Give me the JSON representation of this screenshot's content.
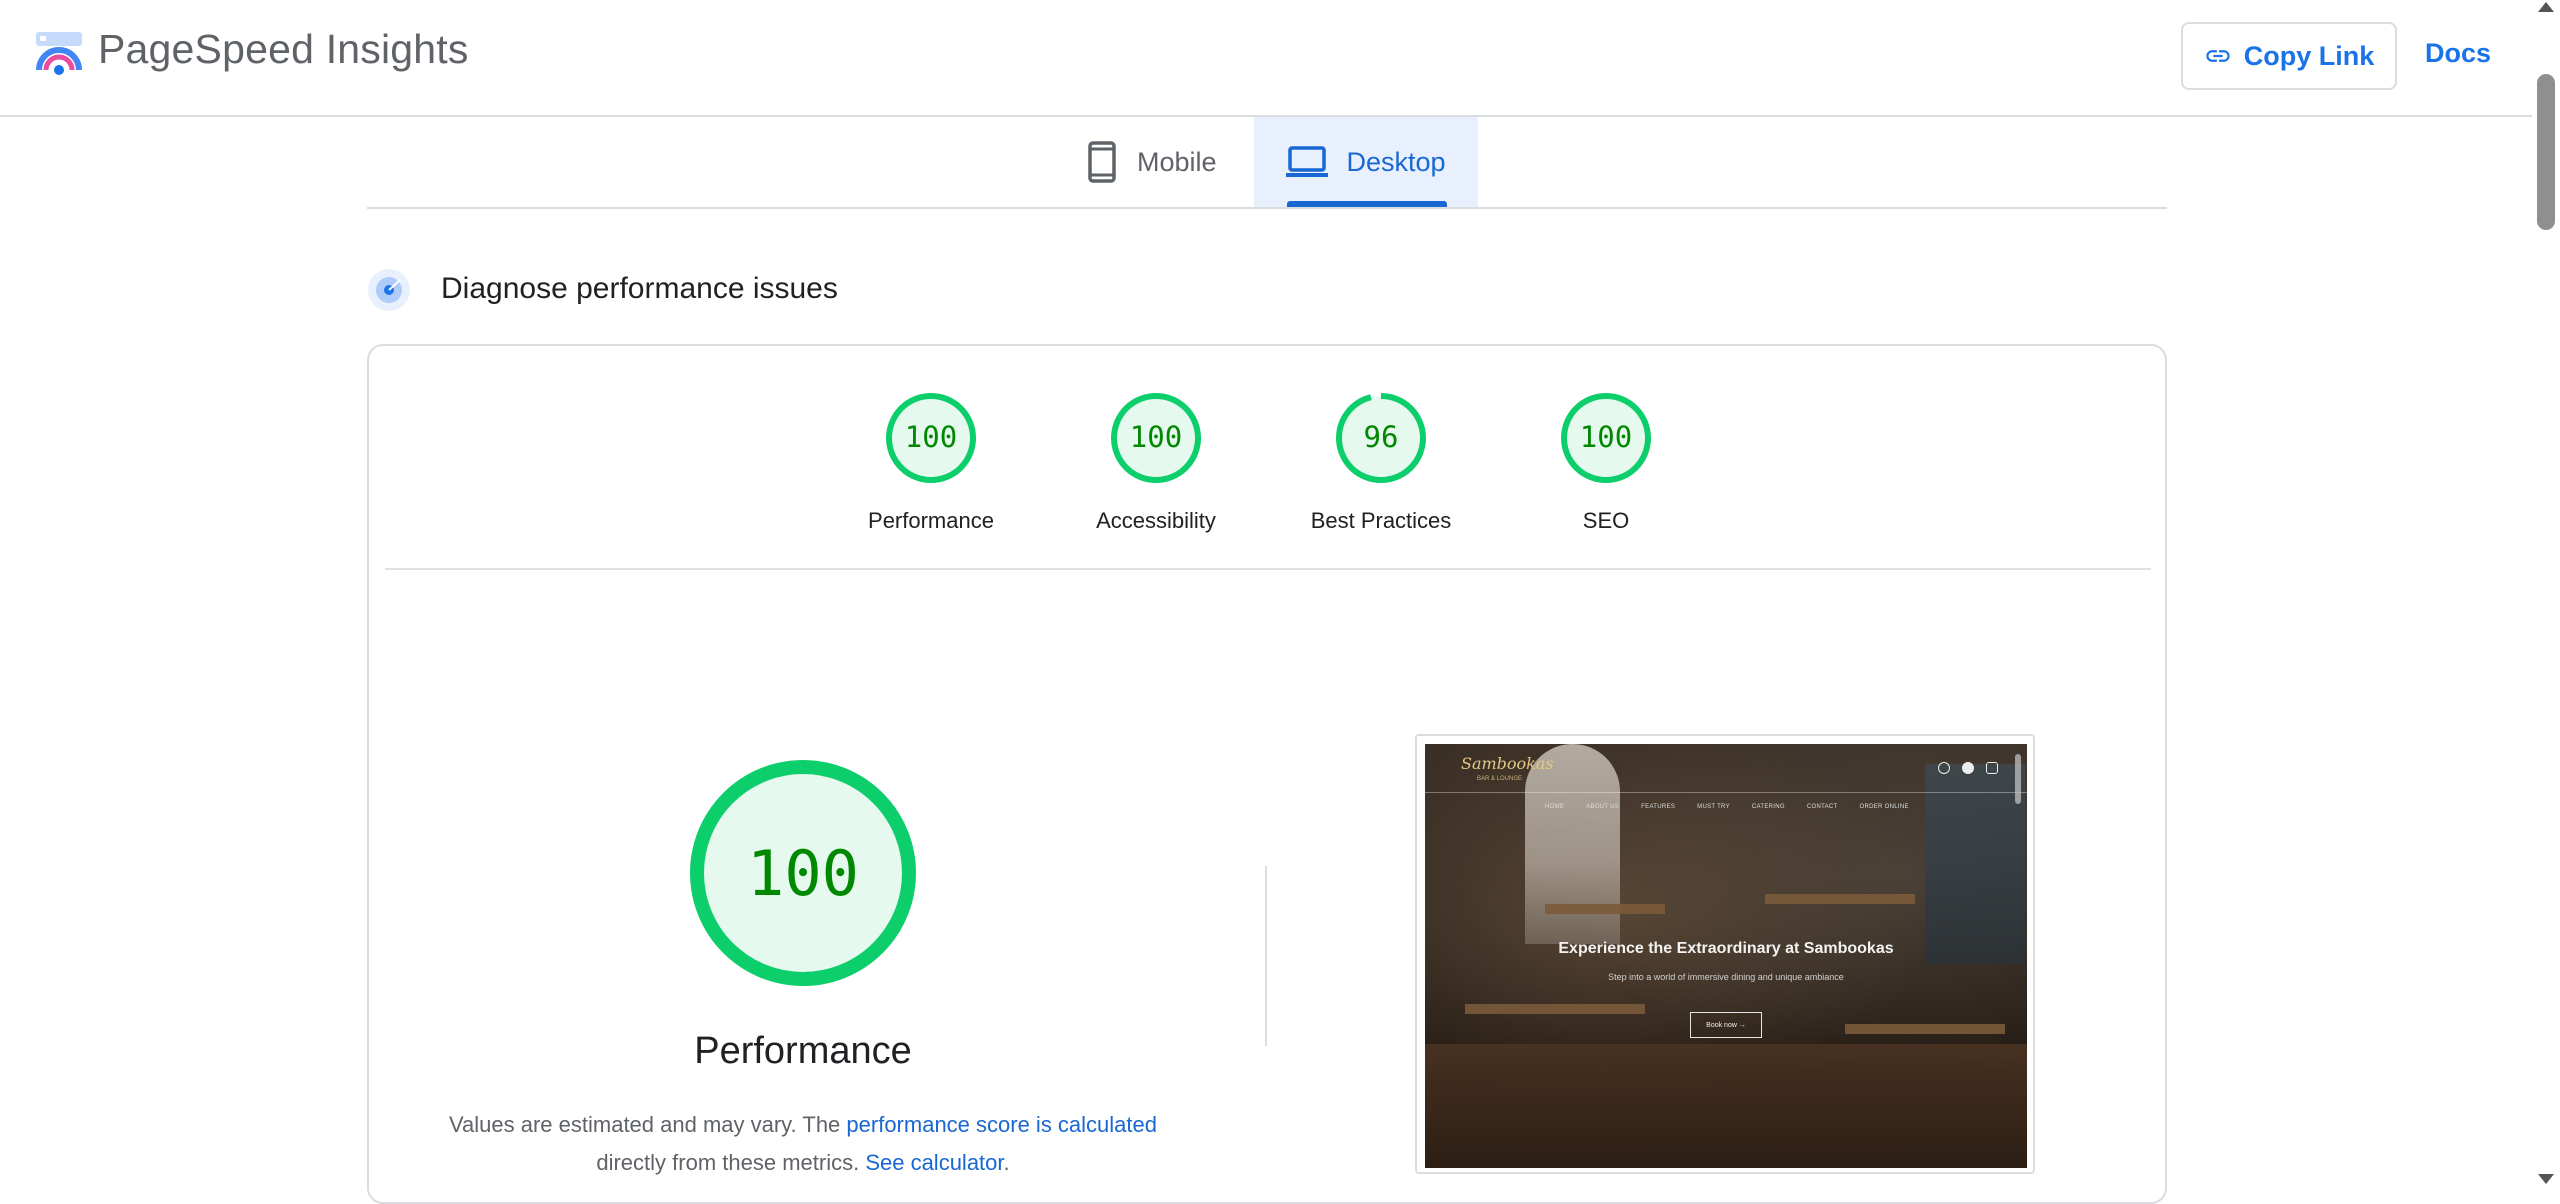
{
  "app": {
    "title": "PageSpeed Insights"
  },
  "header": {
    "copy_link_label": "Copy Link",
    "docs_label": "Docs"
  },
  "tabs": [
    {
      "label": "Mobile",
      "icon": "smartphone-icon",
      "selected": false
    },
    {
      "label": "Desktop",
      "icon": "laptop-icon",
      "selected": true
    }
  ],
  "section": {
    "title": "Diagnose performance issues"
  },
  "scores": [
    {
      "label": "Performance",
      "value": "100",
      "fraction": 1.0
    },
    {
      "label": "Accessibility",
      "value": "100",
      "fraction": 1.0
    },
    {
      "label": "Best Practices",
      "value": "96",
      "fraction": 0.96
    },
    {
      "label": "SEO",
      "value": "100",
      "fraction": 1.0
    }
  ],
  "performance": {
    "score": "100",
    "fraction": 1.0,
    "title": "Performance",
    "desc_prefix": "Values are estimated and may vary. The ",
    "desc_link1": "performance score is calculated",
    "desc_middle": " directly from these metrics. ",
    "desc_link2": "See calculator",
    "desc_suffix": "."
  },
  "thumbnail": {
    "logo": "Sambookas",
    "logo_sub": "BAR & LOUNGE",
    "nav": [
      "HOME",
      "ABOUT US",
      "FEATURES",
      "MUST TRY",
      "CATERING",
      "CONTACT",
      "ORDER ONLINE"
    ],
    "hero": "Experience the Extraordinary at Sambookas",
    "sub": "Step into a world of immersive dining and unique ambiance",
    "button": "Book now →"
  },
  "colors": {
    "pass": "#0cce6b",
    "pass_text": "#008800",
    "pass_bg": "#e6f9ee",
    "accent": "#1a73e8"
  }
}
